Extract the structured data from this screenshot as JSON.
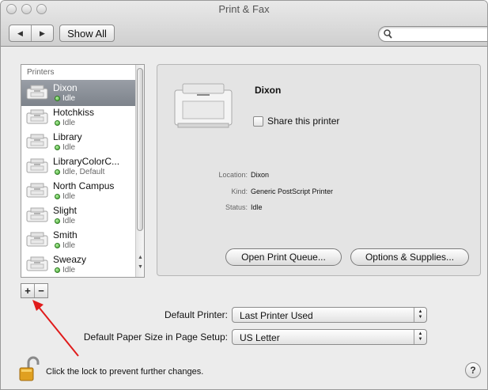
{
  "window": {
    "title": "Print & Fax",
    "back_icon": "◀",
    "forward_icon": "▶",
    "show_all_label": "Show All",
    "search_placeholder": ""
  },
  "sidebar": {
    "header": "Printers",
    "printers": [
      {
        "name": "Dixon",
        "status": "Idle",
        "selected": true
      },
      {
        "name": "Hotchkiss",
        "status": "Idle"
      },
      {
        "name": "Library",
        "status": "Idle"
      },
      {
        "name": "LibraryColorC...",
        "status": "Idle, Default"
      },
      {
        "name": "North Campus",
        "status": "Idle"
      },
      {
        "name": "Slight",
        "status": "Idle"
      },
      {
        "name": "Smith",
        "status": "Idle"
      },
      {
        "name": "Sweazy",
        "status": "Idle"
      }
    ],
    "add_label": "+",
    "remove_label": "−"
  },
  "detail": {
    "printer_name": "Dixon",
    "share_label": "Share this printer",
    "share_checked": false,
    "location_key": "Location:",
    "location_value": "Dixon",
    "kind_key": "Kind:",
    "kind_value": "Generic PostScript Printer",
    "status_key": "Status:",
    "status_value": "Idle",
    "open_queue_label": "Open Print Queue...",
    "options_label": "Options & Supplies..."
  },
  "defaults": {
    "printer_label": "Default Printer:",
    "printer_value": "Last Printer Used",
    "paper_label": "Default Paper Size in Page Setup:",
    "paper_value": "US Letter"
  },
  "footer": {
    "lock_text": "Click the lock to prevent further changes.",
    "help_label": "?"
  },
  "colors": {
    "selection": "#8a8f97",
    "status_dot": "#3fa12e",
    "annotation_arrow": "#e01b1b"
  }
}
